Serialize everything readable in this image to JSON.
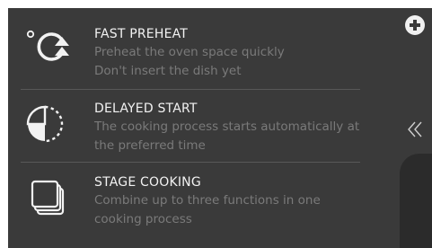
{
  "menu": {
    "items": [
      {
        "title": "FAST PREHEAT",
        "desc_line1": "Preheat the oven space quickly",
        "desc_line2": "Don't insert the dish yet",
        "icon": "fast-preheat-icon"
      },
      {
        "title": "DELAYED START",
        "desc_line1": "The cooking process starts automatically at",
        "desc_line2": "the preferred time",
        "icon": "delayed-start-icon"
      },
      {
        "title": "STAGE COOKING",
        "desc_line1": "Combine up to three functions in one",
        "desc_line2": "cooking process",
        "icon": "stage-cooking-icon"
      }
    ]
  },
  "controls": {
    "add_icon": "plus-circle-icon",
    "collapse_icon": "double-chevron-left-icon"
  },
  "colors": {
    "background": "#3a3a3a",
    "title": "#f2f2f2",
    "description": "#7a7a7a",
    "divider": "#585858",
    "panel": "#2b2b2b"
  }
}
